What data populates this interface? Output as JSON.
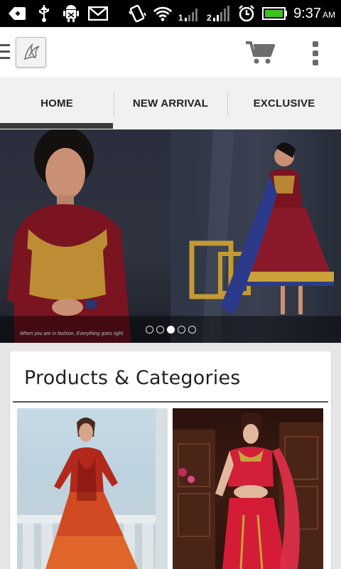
{
  "status_bar": {
    "time": "9:37",
    "ampm": "AM",
    "icons": [
      "notification-icon",
      "usb-icon",
      "android-debug-icon",
      "gmail-icon",
      "vibrate-icon",
      "wifi-icon",
      "signal-1-icon",
      "signal-2-icon",
      "alarm-icon",
      "battery-icon"
    ]
  },
  "app_bar": {
    "icons": [
      "menu-icon",
      "logo-icon",
      "cart-icon",
      "overflow-menu-icon"
    ]
  },
  "tabs": [
    {
      "label": "HOME",
      "selected": true
    },
    {
      "label": "NEW ARRIVAL",
      "selected": false
    },
    {
      "label": "EXCLUSIVE",
      "selected": false
    }
  ],
  "banner": {
    "caption": "When you are in fashion, Everything goes right",
    "page_count": 5,
    "active_page": 3
  },
  "colors": {
    "gown_maroon": "#7a1420",
    "gold_embroidery": "#c9a23a",
    "battery_green": "#3ec21e"
  },
  "products_card": {
    "title": "Products & Categories"
  }
}
